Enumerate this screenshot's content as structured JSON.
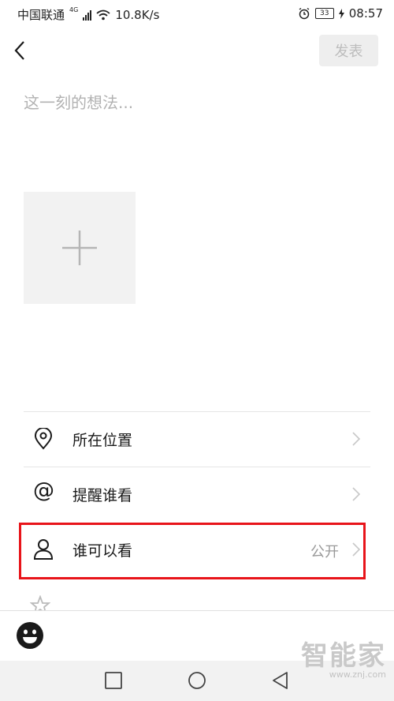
{
  "status_bar": {
    "carrier": "中国联通",
    "network_type": "4G",
    "speed": "10.8K/s",
    "battery": "33",
    "time": "08:57"
  },
  "header": {
    "back_icon": "back-arrow-icon",
    "publish_label": "发表"
  },
  "composer": {
    "placeholder": "这一刻的想法...",
    "value": ""
  },
  "options": [
    {
      "label": "所在位置",
      "icon": "location-pin-icon",
      "value": ""
    },
    {
      "label": "提醒谁看",
      "icon": "at-icon",
      "value": ""
    },
    {
      "label": "谁可以看",
      "icon": "person-icon",
      "value": "公开"
    }
  ],
  "colors": {
    "highlight": "#e8141a",
    "publish_disabled_bg": "#eeeeee",
    "publish_disabled_text": "#bdbdbd"
  },
  "bottom": {
    "emoji_icon": "emoji-icon"
  },
  "nav": {
    "recent": "square-icon",
    "home": "circle-icon",
    "back": "triangle-back-icon"
  },
  "watermark": {
    "name": "智能家",
    "url": "www.znj.com"
  }
}
